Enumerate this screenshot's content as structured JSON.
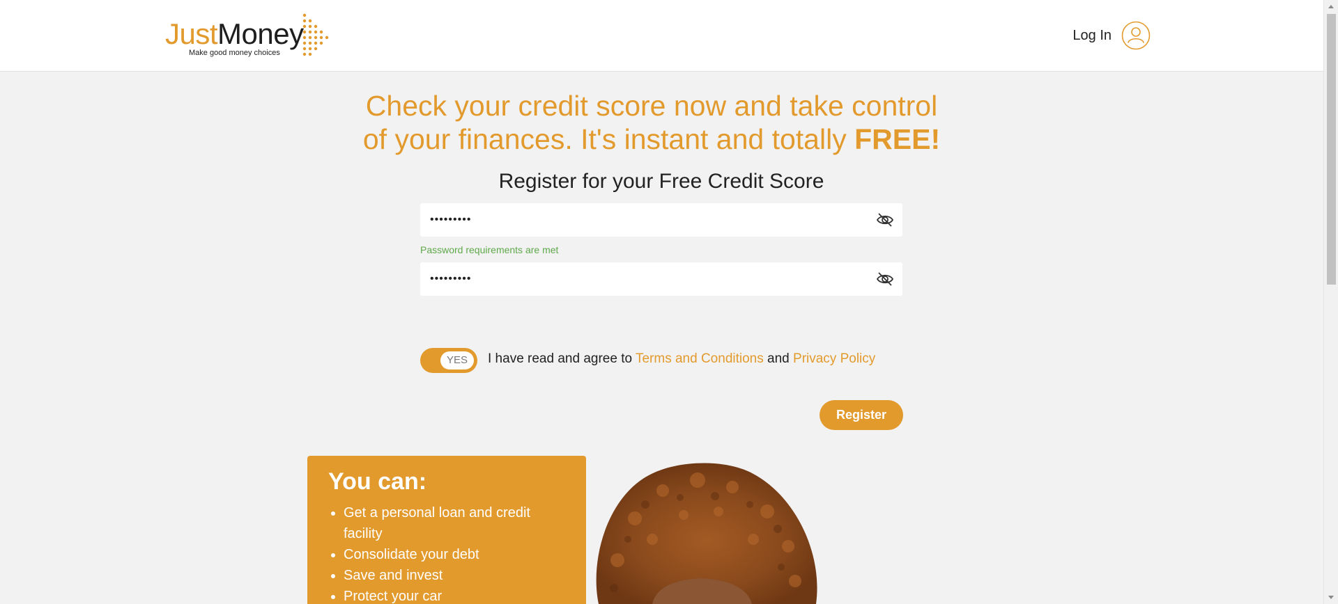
{
  "header": {
    "logo": {
      "word1": "Just",
      "word2": "Money",
      "tagline": "Make good money choices"
    },
    "login_label": "Log In"
  },
  "hero": {
    "line": "Check your credit score now and take control of your finances. It's instant and totally",
    "strong": "FREE!"
  },
  "form": {
    "title": "Register for your Free Credit Score",
    "password": {
      "value": "•••••••••"
    },
    "password_hint": "Password requirements are met",
    "confirm_password": {
      "value": "•••••••••"
    },
    "agree_toggle": {
      "label": "YES",
      "checked": true
    },
    "agree_text": {
      "prefix": "I have read and agree to",
      "terms": "Terms and Conditions",
      "and": "and",
      "privacy": "Privacy Policy"
    },
    "register_label": "Register"
  },
  "promo": {
    "title": "You can:",
    "items": [
      "Get a personal loan and credit facility",
      "Consolidate your debt",
      "Save and invest",
      "Protect your car"
    ]
  },
  "colors": {
    "brand": "#e39a2d",
    "success": "#5fa84b",
    "background": "#f2f2f2"
  },
  "icons": {
    "eye": "eye-slash-icon",
    "user": "user-circle-icon"
  }
}
